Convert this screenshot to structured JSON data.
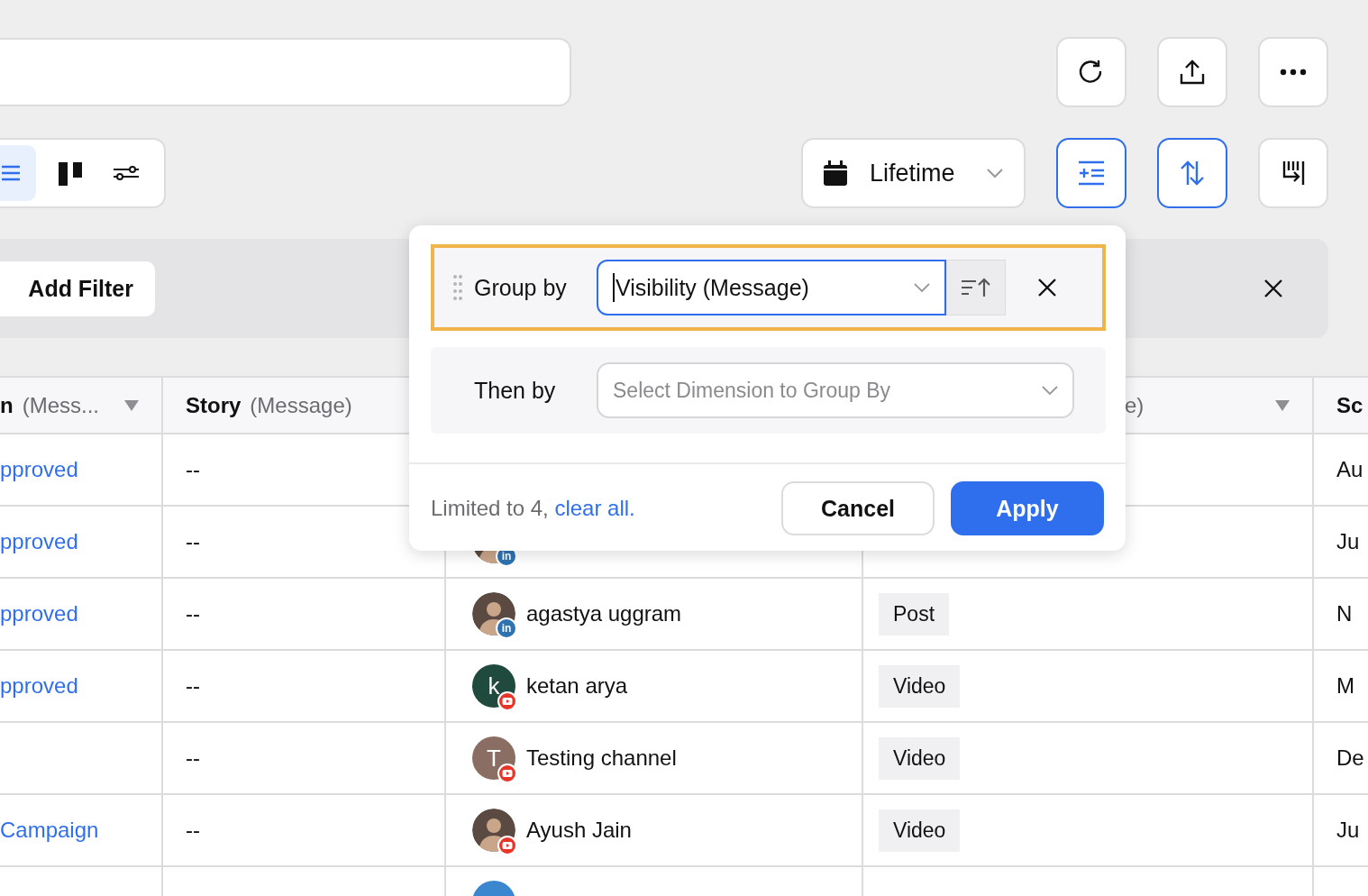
{
  "view_toggle": [
    {
      "kind": "list",
      "selected": true
    },
    {
      "kind": "board",
      "selected": false
    },
    {
      "kind": "filters",
      "selected": false
    }
  ],
  "top_actions": [
    {
      "kind": "refresh"
    },
    {
      "kind": "upload"
    },
    {
      "kind": "more"
    }
  ],
  "date_range": {
    "label": "Lifetime"
  },
  "view_actions": [
    {
      "kind": "group",
      "selected": true
    },
    {
      "kind": "sort",
      "selected": true
    },
    {
      "kind": "columns",
      "selected": false
    }
  ],
  "filter_bar": {
    "add_filter": "Add Filter"
  },
  "table": {
    "columns": [
      {
        "title": "n",
        "qualifier": "(Mess...",
        "filter": true
      },
      {
        "title": "Story",
        "qualifier": "(Message)",
        "filter": false
      },
      {},
      {
        "qualifier": "e)",
        "filter": true
      },
      {
        "title": "Sc"
      }
    ],
    "rows": [
      {
        "status": "pproved",
        "story": "--",
        "date": "Au"
      },
      {
        "status": "pproved",
        "story": "--",
        "author": {
          "avatar": {
            "kind": "photo",
            "badge": {
              "kind": "linkedin",
              "text": "in"
            }
          }
        },
        "date": "Ju"
      },
      {
        "status": "pproved",
        "story": "--",
        "author": {
          "avatar": {
            "kind": "photo",
            "badge": {
              "kind": "linkedin",
              "text": "in"
            }
          },
          "name": "agastya uggram"
        },
        "type": "Post",
        "date": "N"
      },
      {
        "status": "pproved",
        "story": "--",
        "author": {
          "avatar": {
            "kind": "letter",
            "letter": "k",
            "color": "#1f4a3d",
            "badge": {
              "kind": "youtube"
            }
          },
          "name": "ketan arya"
        },
        "type": "Video",
        "date": "M"
      },
      {
        "story": "--",
        "author": {
          "avatar": {
            "kind": "letter",
            "letter": "T",
            "color": "#8b6e63",
            "badge": {
              "kind": "youtube"
            }
          },
          "name": "Testing channel"
        },
        "type": "Video",
        "date": "De"
      },
      {
        "status": "Campaign",
        "story": "--",
        "author": {
          "avatar": {
            "kind": "photo",
            "badge": {
              "kind": "youtube"
            }
          },
          "name": "Ayush Jain"
        },
        "type": "Video",
        "date": "Ju"
      },
      {
        "author": {
          "avatar": {
            "kind": "letter",
            "color": "#3a86cf"
          }
        }
      }
    ]
  },
  "group_popover": {
    "group_by": {
      "label": "Group by",
      "value": "Visibility (Message)",
      "focused": true,
      "highlighted": true
    },
    "then_by": {
      "label": "Then by",
      "placeholder": "Select Dimension to Group By"
    },
    "note": "Limited to 4,",
    "link": "clear all.",
    "buttons": [
      {
        "label": "Cancel",
        "kind": "secondary"
      },
      {
        "label": "Apply",
        "kind": "primary"
      }
    ]
  }
}
